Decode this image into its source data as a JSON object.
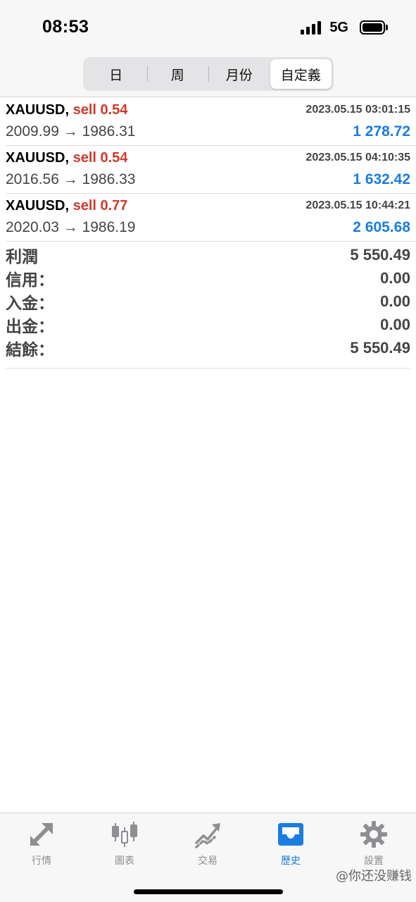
{
  "status_bar": {
    "time": "08:53",
    "network": "5G"
  },
  "period_tabs": [
    {
      "label": "日",
      "active": false
    },
    {
      "label": "周",
      "active": false
    },
    {
      "label": "月份",
      "active": false
    },
    {
      "label": "自定義",
      "active": true
    }
  ],
  "trades": [
    {
      "symbol": "XAUUSD,",
      "side": "sell 0.54",
      "time": "2023.05.15 03:01:15",
      "prices": "2009.99 → 1986.31",
      "profit": "1 278.72"
    },
    {
      "symbol": "XAUUSD,",
      "side": "sell 0.54",
      "time": "2023.05.15 04:10:35",
      "prices": "2016.56 → 1986.33",
      "profit": "1 632.42"
    },
    {
      "symbol": "XAUUSD,",
      "side": "sell 0.77",
      "time": "2023.05.15 10:44:21",
      "prices": "2020.03 → 1986.19",
      "profit": "2 605.68"
    }
  ],
  "summary": [
    {
      "label": "利潤",
      "value": "5 550.49"
    },
    {
      "label": "信用：",
      "value": "0.00"
    },
    {
      "label": "入金：",
      "value": "0.00"
    },
    {
      "label": "出金：",
      "value": "0.00"
    },
    {
      "label": "結餘：",
      "value": "5 550.49"
    }
  ],
  "tab_bar": [
    {
      "label": "行情",
      "icon": "quotes-arrows-icon",
      "active": false
    },
    {
      "label": "圖表",
      "icon": "candlestick-chart-icon",
      "active": false
    },
    {
      "label": "交易",
      "icon": "trade-trend-icon",
      "active": false
    },
    {
      "label": "歷史",
      "icon": "history-inbox-icon",
      "active": true
    },
    {
      "label": "設置",
      "icon": "gear-icon",
      "active": false
    }
  ],
  "watermark": "@你还没赚钱",
  "colors": {
    "accent": "#1a7de0",
    "sell": "#d0392b",
    "inactive_icon": "#8e8e93"
  }
}
